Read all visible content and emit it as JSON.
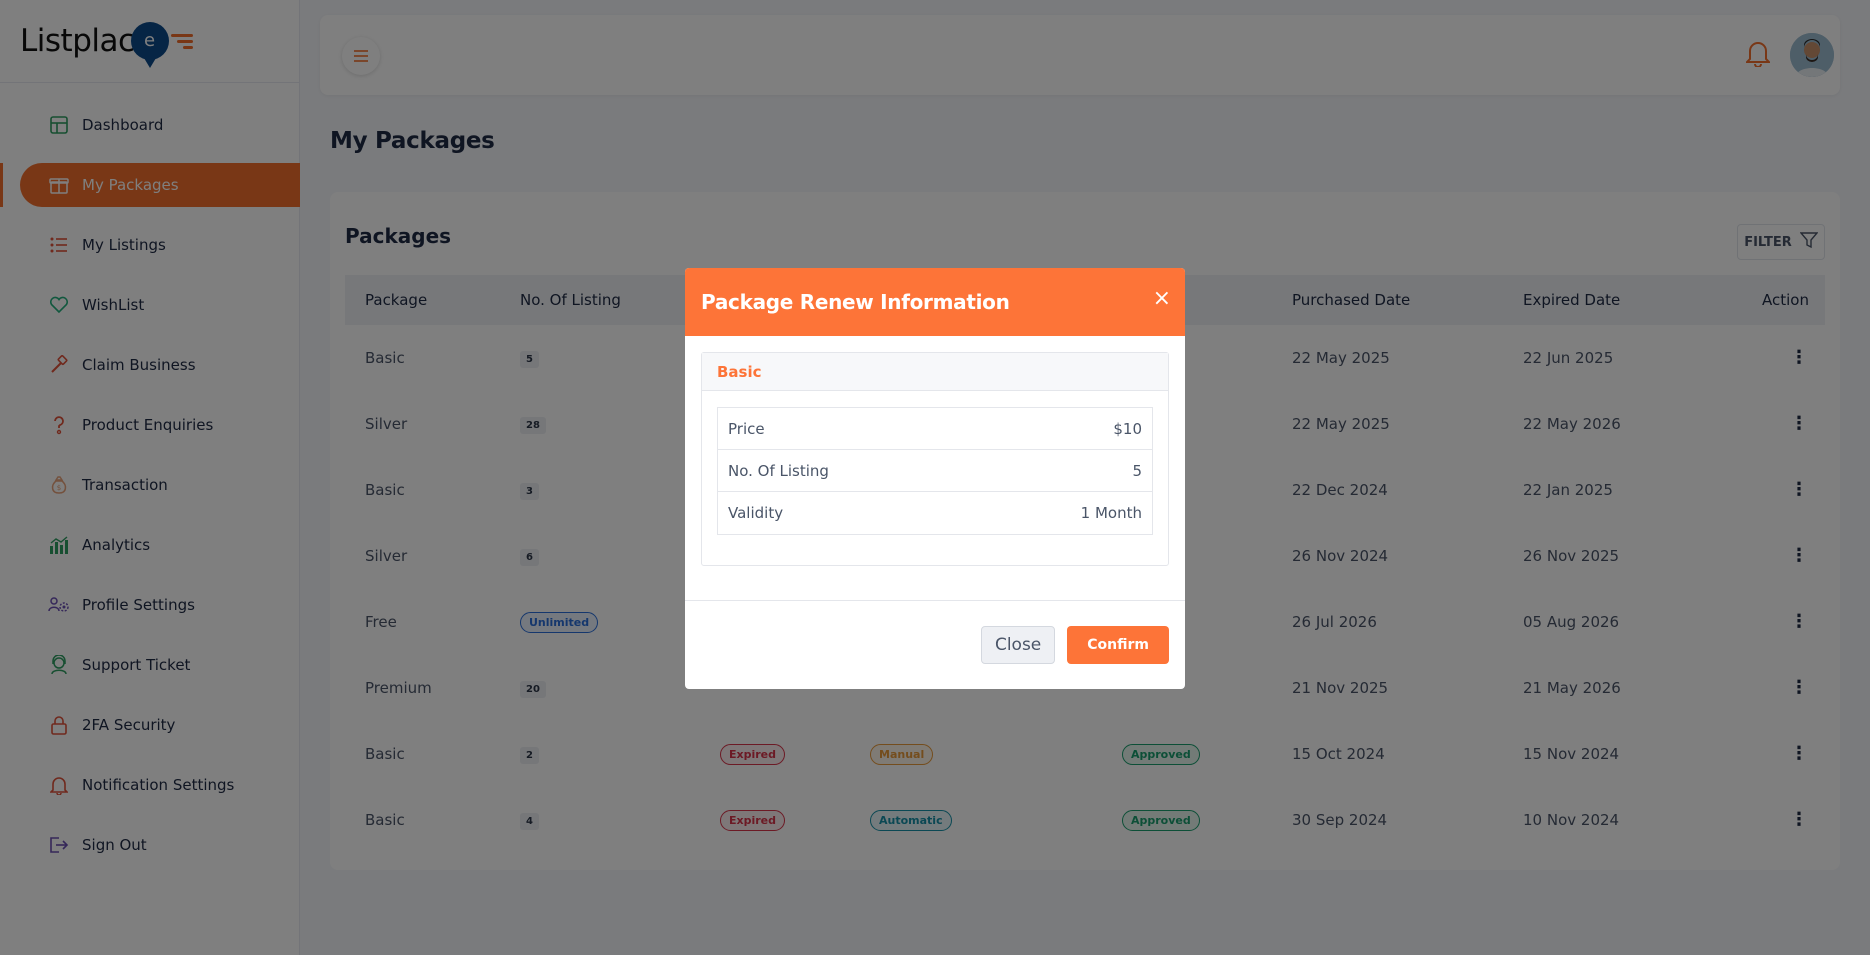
{
  "app": {
    "logo_text": "Listplac",
    "logo_letter": "e"
  },
  "colors": {
    "accent": "#f36e2c",
    "modal_header": "#fd7438"
  },
  "sidebar": {
    "items": [
      {
        "label": "Dashboard",
        "icon": "dashboard-icon"
      },
      {
        "label": "My Packages",
        "icon": "package-icon",
        "active": true
      },
      {
        "label": "My Listings",
        "icon": "list-icon"
      },
      {
        "label": "WishList",
        "icon": "heart-icon"
      },
      {
        "label": "Claim Business",
        "icon": "hammer-icon"
      },
      {
        "label": "Product Enquiries",
        "icon": "question-icon"
      },
      {
        "label": "Transaction",
        "icon": "money-bag-icon"
      },
      {
        "label": "Analytics",
        "icon": "bar-chart-icon"
      },
      {
        "label": "Profile Settings",
        "icon": "users-gear-icon"
      },
      {
        "label": "Support Ticket",
        "icon": "support-icon"
      },
      {
        "label": "2FA Security",
        "icon": "lock-icon"
      },
      {
        "label": "Notification Settings",
        "icon": "bell-icon"
      },
      {
        "label": "Sign Out",
        "icon": "sign-out-icon"
      }
    ]
  },
  "page": {
    "title": "My Packages"
  },
  "card": {
    "title": "Packages",
    "filter_label": "FILTER"
  },
  "table": {
    "headers": [
      "Package",
      "No. Of Listing",
      "",
      "",
      "",
      "Purchased Date",
      "Expired Date",
      "Action"
    ],
    "rows": [
      {
        "package": "Basic",
        "listings": "5",
        "status": "",
        "mode": "",
        "payment": "",
        "purchased": "22 May 2025",
        "expired": "22 Jun 2025"
      },
      {
        "package": "Silver",
        "listings": "28",
        "status": "",
        "mode": "",
        "payment": "",
        "purchased": "22 May 2025",
        "expired": "22 May 2026"
      },
      {
        "package": "Basic",
        "listings": "3",
        "status": "",
        "mode": "",
        "payment": "",
        "purchased": "22 Dec 2024",
        "expired": "22 Jan 2025"
      },
      {
        "package": "Silver",
        "listings": "6",
        "status": "",
        "mode": "",
        "payment": "",
        "purchased": "26 Nov 2024",
        "expired": "26 Nov 2025"
      },
      {
        "package": "Free",
        "listings": "Unlimited",
        "status": "",
        "mode": "",
        "payment": "",
        "purchased": "26 Jul 2026",
        "expired": "05 Aug 2026"
      },
      {
        "package": "Premium",
        "listings": "20",
        "status": "",
        "mode": "",
        "payment": "",
        "purchased": "21 Nov 2025",
        "expired": "21 May 2026"
      },
      {
        "package": "Basic",
        "listings": "2",
        "status": "Expired",
        "mode": "Manual",
        "payment": "Approved",
        "purchased": "15 Oct 2024",
        "expired": "15 Nov 2024"
      },
      {
        "package": "Basic",
        "listings": "4",
        "status": "Expired",
        "mode": "Automatic",
        "payment": "Approved",
        "purchased": "30 Sep 2024",
        "expired": "10 Nov 2024"
      }
    ]
  },
  "modal": {
    "title": "Package Renew Information",
    "close_glyph": "×",
    "package_name": "Basic",
    "details": [
      {
        "label": "Price",
        "value": "$10"
      },
      {
        "label": "No. Of Listing",
        "value": "5"
      },
      {
        "label": "Validity",
        "value": "1 Month"
      }
    ],
    "close_label": "Close",
    "confirm_label": "Confirm"
  }
}
